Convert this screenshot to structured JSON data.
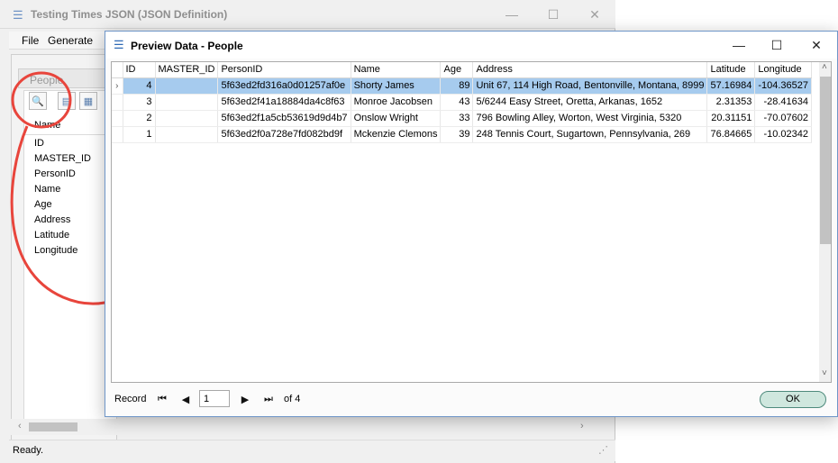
{
  "main_window": {
    "title": "Testing Times JSON (JSON Definition)",
    "menu": [
      "File",
      "Generate"
    ],
    "panel_tab": "People",
    "field_header": "Name",
    "fields": [
      "ID",
      "MASTER_ID",
      "PersonID",
      "Name",
      "Age",
      "Address",
      "Latitude",
      "Longitude"
    ],
    "status": "Ready.",
    "icons": {
      "minimize": "minimize-icon",
      "maximize": "maximize-icon",
      "close": "close-icon"
    }
  },
  "dialog": {
    "title": "Preview Data - People",
    "columns": [
      "ID",
      "MASTER_ID",
      "PersonID",
      "Name",
      "Age",
      "Address",
      "Latitude",
      "Longitude"
    ],
    "rows": [
      {
        "id": "4",
        "master_id": "",
        "person_id": "5f63ed2fd316a0d01257af0e",
        "name": "Shorty James",
        "age": "89",
        "address": "Unit 67, 114 High Road, Bentonville, Montana, 8999",
        "latitude": "57.16984",
        "longitude": "-104.36527",
        "selected": true
      },
      {
        "id": "3",
        "master_id": "",
        "person_id": "5f63ed2f41a18884da4c8f63",
        "name": "Monroe Jacobsen",
        "age": "43",
        "address": "5/6244 Easy Street, Oretta, Arkanas, 1652",
        "latitude": "2.31353",
        "longitude": "-28.41634",
        "selected": false
      },
      {
        "id": "2",
        "master_id": "",
        "person_id": "5f63ed2f1a5cb53619d9d4b7",
        "name": "Onslow Wright",
        "age": "33",
        "address": "796 Bowling Alley, Worton, West Virginia, 5320",
        "latitude": "20.31151",
        "longitude": "-70.07602",
        "selected": false
      },
      {
        "id": "1",
        "master_id": "",
        "person_id": "5f63ed2f0a728e7fd082bd9f",
        "name": "Mckenzie Clemons",
        "age": "39",
        "address": "248 Tennis Court, Sugartown, Pennsylvania, 269",
        "latitude": "76.84665",
        "longitude": "-10.02342",
        "selected": false
      }
    ],
    "nav": {
      "label": "Record",
      "current": "1",
      "of": "of 4"
    },
    "ok_label": "OK"
  },
  "annotation_color": "#e8453c"
}
